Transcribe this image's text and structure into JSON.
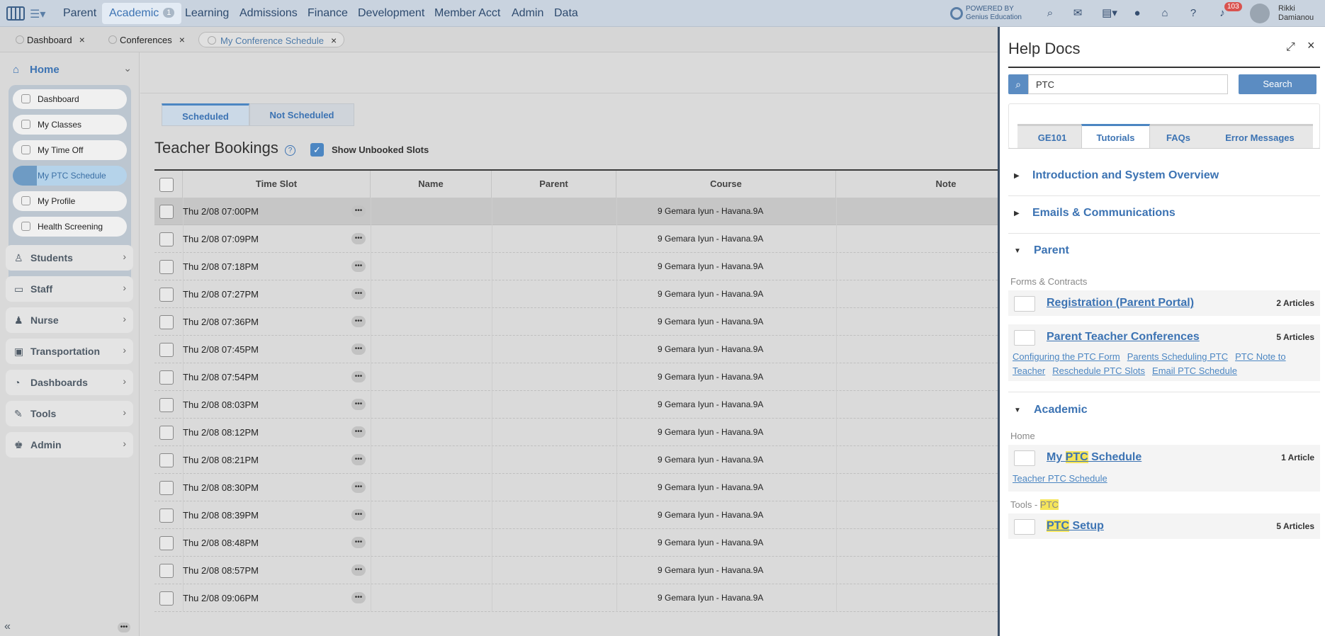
{
  "topnav": {
    "items": [
      {
        "label": "Parent"
      },
      {
        "label": "Academic",
        "badge": "1"
      },
      {
        "label": "Learning"
      },
      {
        "label": "Admissions"
      },
      {
        "label": "Finance"
      },
      {
        "label": "Development"
      },
      {
        "label": "Member Acct"
      },
      {
        "label": "Admin"
      },
      {
        "label": "Data"
      }
    ],
    "powered_line1": "POWERED BY",
    "powered_line2": "Genius Education",
    "notification_count": "103",
    "user_first": "Rikki",
    "user_last": "Damianou"
  },
  "tabs": [
    {
      "label": "Dashboard"
    },
    {
      "label": "Conferences"
    },
    {
      "label": "My Conference Schedule"
    }
  ],
  "sidebar": {
    "home_label": "Home",
    "home_items": [
      {
        "label": "Dashboard"
      },
      {
        "label": "My Classes"
      },
      {
        "label": "My Time Off"
      },
      {
        "label": "My PTC Schedule"
      },
      {
        "label": "My Profile"
      },
      {
        "label": "Health Screening"
      }
    ],
    "groups": [
      {
        "label": "Students"
      },
      {
        "label": "Staff"
      },
      {
        "label": "Nurse"
      },
      {
        "label": "Transportation"
      },
      {
        "label": "Dashboards"
      },
      {
        "label": "Tools"
      },
      {
        "label": "Admin"
      }
    ]
  },
  "main": {
    "subtabs": [
      {
        "label": "Scheduled"
      },
      {
        "label": "Not Scheduled"
      }
    ],
    "title": "Teacher Bookings",
    "show_unbooked_label": "Show Unbooked Slots",
    "columns": [
      "Time Slot",
      "Name",
      "Parent",
      "Course",
      "Note"
    ],
    "rows": [
      {
        "time": "Thu 2/08 07:00PM",
        "course": "9 Gemara Iyun - Havana.9A"
      },
      {
        "time": "Thu 2/08 07:09PM",
        "course": "9 Gemara Iyun - Havana.9A"
      },
      {
        "time": "Thu 2/08 07:18PM",
        "course": "9 Gemara Iyun - Havana.9A"
      },
      {
        "time": "Thu 2/08 07:27PM",
        "course": "9 Gemara Iyun - Havana.9A"
      },
      {
        "time": "Thu 2/08 07:36PM",
        "course": "9 Gemara Iyun - Havana.9A"
      },
      {
        "time": "Thu 2/08 07:45PM",
        "course": "9 Gemara Iyun - Havana.9A"
      },
      {
        "time": "Thu 2/08 07:54PM",
        "course": "9 Gemara Iyun - Havana.9A"
      },
      {
        "time": "Thu 2/08 08:03PM",
        "course": "9 Gemara Iyun - Havana.9A"
      },
      {
        "time": "Thu 2/08 08:12PM",
        "course": "9 Gemara Iyun - Havana.9A"
      },
      {
        "time": "Thu 2/08 08:21PM",
        "course": "9 Gemara Iyun - Havana.9A"
      },
      {
        "time": "Thu 2/08 08:30PM",
        "course": "9 Gemara Iyun - Havana.9A"
      },
      {
        "time": "Thu 2/08 08:39PM",
        "course": "9 Gemara Iyun - Havana.9A"
      },
      {
        "time": "Thu 2/08 08:48PM",
        "course": "9 Gemara Iyun - Havana.9A"
      },
      {
        "time": "Thu 2/08 08:57PM",
        "course": "9 Gemara Iyun - Havana.9A"
      },
      {
        "time": "Thu 2/08 09:06PM",
        "course": "9 Gemara Iyun - Havana.9A"
      }
    ]
  },
  "help": {
    "title": "Help Docs",
    "search_value": "PTC",
    "search_button": "Search",
    "tabs": [
      {
        "label": "GE101"
      },
      {
        "label": "Tutorials"
      },
      {
        "label": "FAQs"
      },
      {
        "label": "Error Messages"
      }
    ],
    "categories": [
      {
        "label": "Introduction and System Overview"
      },
      {
        "label": "Emails & Communications"
      },
      {
        "label": "Parent"
      },
      {
        "label": "Academic"
      }
    ],
    "parent_sub": "Forms & Contracts",
    "parent_articles": [
      {
        "title": "Registration (Parent Portal)",
        "count": "2 Articles"
      },
      {
        "title": "Parent Teacher Conferences",
        "count": "5 Articles"
      }
    ],
    "ptc_links": [
      "Configuring the PTC Form",
      "Parents Scheduling PTC",
      "PTC Note to Teacher",
      "Reschedule PTC Slots",
      "Email PTC Schedule"
    ],
    "academic_sub_home": "Home",
    "my_ptc": {
      "pre": "My ",
      "hl": "PTC",
      "post": " Schedule",
      "count": "1 Article"
    },
    "my_ptc_link": "Teacher PTC Schedule",
    "academic_sub_tools": {
      "pre": "Tools - ",
      "hl": "PTC"
    },
    "ptc_setup": {
      "hl": "PTC",
      "post": " Setup",
      "count": "5 Articles"
    }
  }
}
